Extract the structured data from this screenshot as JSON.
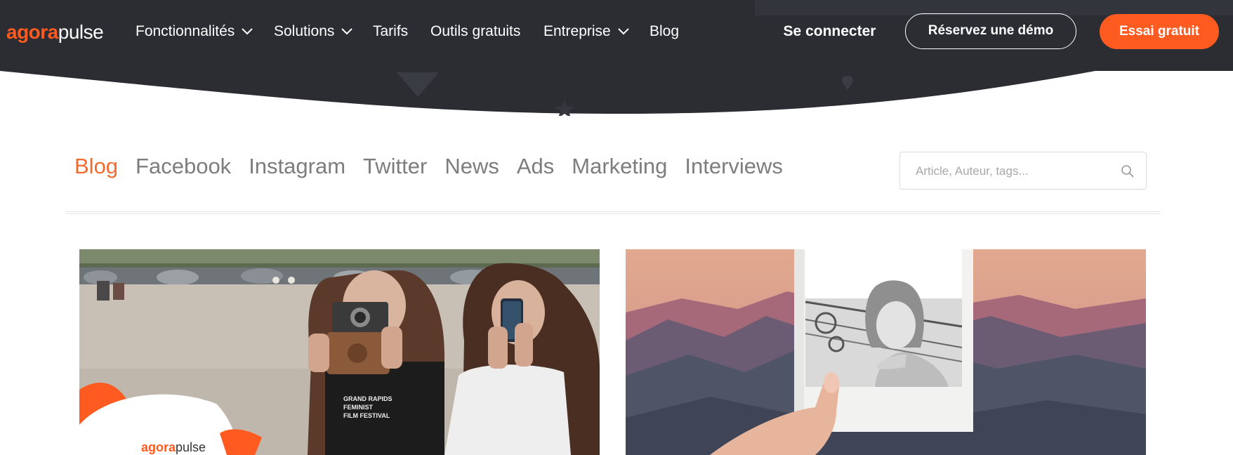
{
  "brand": {
    "logo_part1": "agora",
    "logo_part2": "pulse",
    "primary_color": "#ff5a1f",
    "header_color": "#2b2d33"
  },
  "nav": {
    "items": [
      {
        "label": "Fonctionnalités",
        "has_dropdown": true
      },
      {
        "label": "Solutions",
        "has_dropdown": true
      },
      {
        "label": "Tarifs",
        "has_dropdown": false
      },
      {
        "label": "Outils gratuits",
        "has_dropdown": false
      },
      {
        "label": "Entreprise",
        "has_dropdown": true
      },
      {
        "label": "Blog",
        "has_dropdown": false
      }
    ],
    "login_label": "Se connecter",
    "demo_label": "Réservez une démo",
    "trial_label": "Essai gratuit"
  },
  "categories": {
    "active": "Blog",
    "items": [
      "Blog",
      "Facebook",
      "Instagram",
      "Twitter",
      "News",
      "Ads",
      "Marketing",
      "Interviews"
    ]
  },
  "search": {
    "placeholder": "Article, Auteur, tags...",
    "value": "",
    "icon": "search-icon"
  },
  "cards": [
    {
      "image": "two-women-with-camera-and-phone-photo",
      "shirt_text": [
        "GRAND RAPIDS",
        "FEMINIST",
        "FILM FESTIVAL"
      ],
      "badge_part1": "agora",
      "badge_part2": "pulse"
    },
    {
      "image": "hand-holding-polaroid-portrait-photo"
    }
  ]
}
